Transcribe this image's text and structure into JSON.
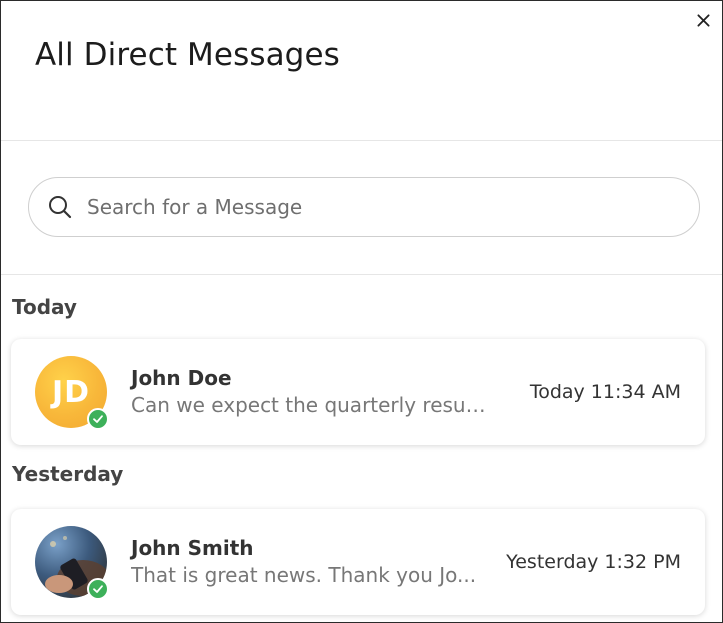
{
  "dialog": {
    "title": "All Direct Messages",
    "close_icon": "close-icon"
  },
  "search": {
    "placeholder": "Search for a Message",
    "value": "",
    "icon": "search-icon"
  },
  "sections": [
    {
      "label": "Today",
      "messages": [
        {
          "name": "John Doe",
          "initials": "JD",
          "preview": "Can we expect the quarterly result...",
          "time": "Today 11:34 AM",
          "status": "online",
          "avatar_color": "#f8b73a"
        }
      ]
    },
    {
      "label": "Yesterday",
      "messages": [
        {
          "name": "John Smith",
          "preview": "That is great news. Thank you Jo...",
          "time": "Yesterday 1:32 PM",
          "status": "online",
          "avatar_type": "photo"
        }
      ]
    }
  ],
  "colors": {
    "status_online": "#3db05a",
    "border": "#cfcfcf"
  }
}
